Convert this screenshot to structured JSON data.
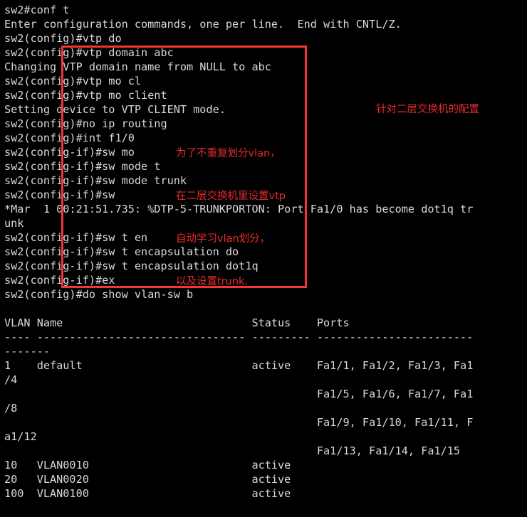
{
  "terminal": {
    "background_color": "#000000",
    "text_color": "#d8d8d8",
    "lines": [
      "sw2#conf t",
      "Enter configuration commands, one per line.  End with CNTL/Z.",
      "sw2(config)#vtp do",
      "sw2(config)#vtp domain abc",
      "Changing VTP domain name from NULL to abc",
      "sw2(config)#vtp mo cl",
      "sw2(config)#vtp mo client",
      "Setting device to VTP CLIENT mode.",
      "sw2(config)#no ip routing",
      "sw2(config)#int f1/0",
      "sw2(config-if)#sw mo",
      "sw2(config-if)#sw mode t",
      "sw2(config-if)#sw mode trunk",
      "sw2(config-if)#sw",
      "*Mar  1 00:21:51.735: %DTP-5-TRUNKPORTON: Port Fa1/0 has become dot1q tr",
      "unk",
      "sw2(config-if)#sw t en",
      "sw2(config-if)#sw t encapsulation do",
      "sw2(config-if)#sw t encapsulation dot1q",
      "sw2(config-if)#ex",
      "sw2(config)#do show vlan-sw b",
      "",
      "VLAN Name                             Status    Ports",
      "---- -------------------------------- --------- ------------------------",
      "-------",
      "1    default                          active    Fa1/1, Fa1/2, Fa1/3, Fa1",
      "/4",
      "                                                Fa1/5, Fa1/6, Fa1/7, Fa1",
      "/8",
      "                                                Fa1/9, Fa1/10, Fa1/11, F",
      "a1/12",
      "                                                Fa1/13, Fa1/14, Fa1/15",
      "10   VLAN0010                         active",
      "20   VLAN0020                         active",
      "100  VLAN0100                         active"
    ]
  },
  "vlan_table": {
    "headers": [
      "VLAN",
      "Name",
      "Status",
      "Ports"
    ],
    "rows": [
      {
        "vlan": "1",
        "name": "default",
        "status": "active",
        "ports": [
          "Fa1/1",
          "Fa1/2",
          "Fa1/3",
          "Fa1/4",
          "Fa1/5",
          "Fa1/6",
          "Fa1/7",
          "Fa1/8",
          "Fa1/9",
          "Fa1/10",
          "Fa1/11",
          "Fa1/12",
          "Fa1/13",
          "Fa1/14",
          "Fa1/15"
        ]
      },
      {
        "vlan": "10",
        "name": "VLAN0010",
        "status": "active",
        "ports": []
      },
      {
        "vlan": "20",
        "name": "VLAN0020",
        "status": "active",
        "ports": []
      },
      {
        "vlan": "100",
        "name": "VLAN0100",
        "status": "active",
        "ports": []
      }
    ]
  },
  "annotations": {
    "rect_color": "#f53535",
    "note_color": "#e82c2c",
    "right_note": "针对二层交换机的配置",
    "left_note_lines": [
      "为了不重复划分vlan，",
      "在二层交换机里设置vtp",
      "自动学习vlan划分，",
      "以及设置trunk."
    ]
  }
}
